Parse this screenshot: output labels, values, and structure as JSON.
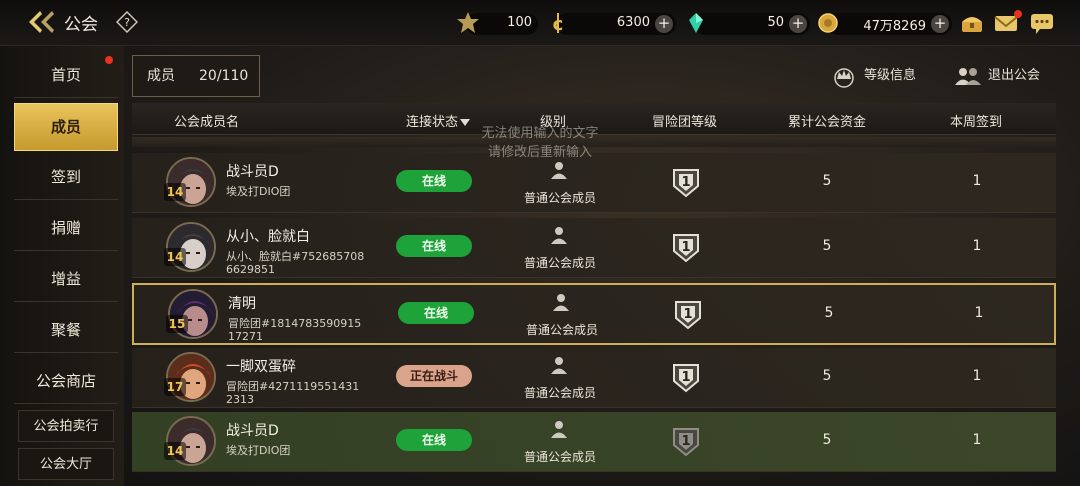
{
  "topbar": {
    "title": "公会",
    "resources": [
      {
        "icon": "fatigue-icon",
        "value": "100"
      },
      {
        "icon": "gold-c-icon",
        "value": "6300"
      },
      {
        "icon": "crystal-icon",
        "value": "50"
      },
      {
        "icon": "coin-icon",
        "value": "47万8269"
      }
    ]
  },
  "sidebar": {
    "items": [
      {
        "label": "首页",
        "notify": true
      },
      {
        "label": "成员",
        "active": true
      },
      {
        "label": "签到"
      },
      {
        "label": "捐赠"
      },
      {
        "label": "增益"
      },
      {
        "label": "聚餐"
      },
      {
        "label": "公会商店"
      }
    ],
    "buttons": [
      {
        "label": "公会拍卖行"
      },
      {
        "label": "公会大厅"
      }
    ]
  },
  "members_header": {
    "label": "成员",
    "count": "20/110",
    "level_info": "等级信息",
    "leave_guild": "退出公会"
  },
  "table": {
    "columns": [
      "公会成员名",
      "连接状态",
      "级别",
      "冒险团等级",
      "累计公会资金",
      "本周签到"
    ],
    "toast_line1": "无法使用输入的文字",
    "toast_line2": "请修改后重新输入",
    "rows": [
      {
        "name": "战斗员D",
        "sub": "埃及打DIO团",
        "level": "14",
        "status": "在线",
        "status_type": "online",
        "rank": "普通公会成员",
        "adventure_level": "1",
        "fund": "5",
        "checkin": "1"
      },
      {
        "name": "从小、脸就白",
        "sub": "从小、脸就白#7526857086629851",
        "level": "14",
        "status": "在线",
        "status_type": "online",
        "rank": "普通公会成员",
        "adventure_level": "1",
        "fund": "5",
        "checkin": "1"
      },
      {
        "name": "清明",
        "sub": "冒险团#181478359091517271",
        "level": "15",
        "status": "在线",
        "status_type": "online",
        "rank": "普通公会成员",
        "adventure_level": "1",
        "fund": "5",
        "checkin": "1",
        "selected": true
      },
      {
        "name": "一脚双蛋碎",
        "sub": "冒险团#42711195514312313",
        "level": "17",
        "status": "正在战斗",
        "status_type": "battle",
        "rank": "普通公会成员",
        "adventure_level": "1",
        "fund": "5",
        "checkin": "1"
      },
      {
        "name": "战斗员D",
        "sub": "埃及打DIO团",
        "level": "14",
        "status": "在线",
        "status_type": "online",
        "rank": "普通公会成员",
        "adventure_level": "1",
        "fund": "5",
        "checkin": "1",
        "self": true
      }
    ]
  },
  "colors": {
    "accent_gold": "#e9c35c",
    "online_green": "#1ea33a",
    "battle_pink": "#d9a38c",
    "notify_red": "#e8311e"
  }
}
